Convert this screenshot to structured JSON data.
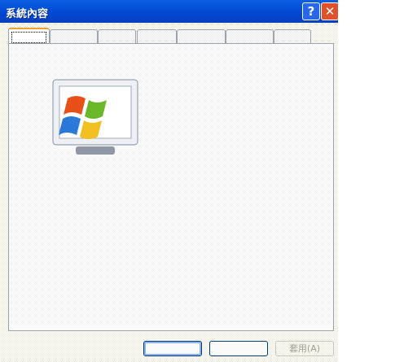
{
  "window": {
    "title": "系統內容",
    "help_icon": "question-icon",
    "close_icon": "close-icon"
  },
  "tabs": {
    "count": 7,
    "active_index": 0
  },
  "buttons": {
    "ok": "",
    "cancel": "",
    "apply": "套用(A)"
  },
  "colors": {
    "titlebar": "#0047d0",
    "close": "#e0502a",
    "tab_highlight": "#f0a030"
  }
}
